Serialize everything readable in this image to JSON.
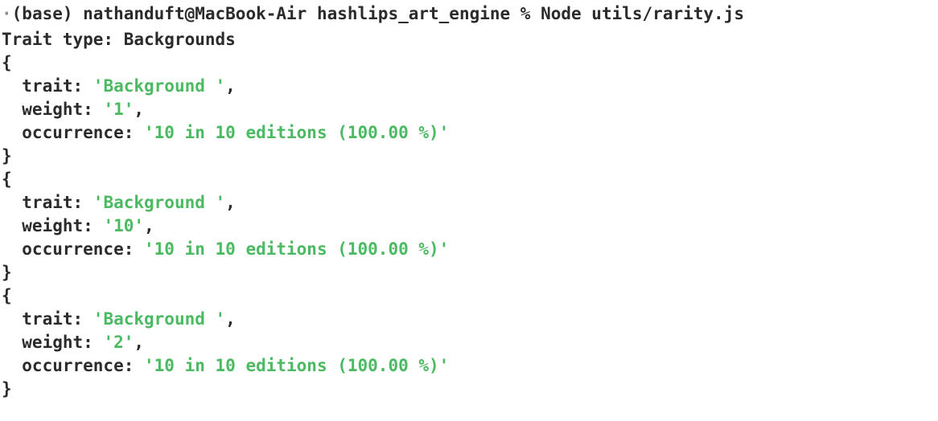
{
  "terminal": {
    "colors": {
      "background": "#ffffff",
      "foreground": "#2b2b2b",
      "string": "#4cba62"
    },
    "prompt_line": {
      "leading_stub": "·",
      "env": "(base)",
      "user_host": "nathanduft@MacBook-Air",
      "cwd": "hashlips_art_engine",
      "prompt_symbol": "%",
      "command": "Node utils/rarity.js",
      "full_text": "(base) nathanduft@MacBook-Air hashlips_art_engine % Node utils/rarity.js"
    },
    "header_line": {
      "label": "Trait type:",
      "value": "Backgrounds",
      "full_text": "Trait type: Backgrounds"
    },
    "open_brace": "{",
    "close_brace": "}",
    "field_labels": {
      "trait": "  trait: ",
      "weight": "  weight: ",
      "occurrence": "  occurrence: "
    },
    "comma": ",",
    "blocks": [
      {
        "trait": "'Background '",
        "weight": "'1'",
        "occurrence": "'10 in 10 editions (100.00 %)'"
      },
      {
        "trait": "'Background '",
        "weight": "'10'",
        "occurrence": "'10 in 10 editions (100.00 %)'"
      },
      {
        "trait": "'Background '",
        "weight": "'2'",
        "occurrence": "'10 in 10 editions (100.00 %)'"
      }
    ]
  }
}
